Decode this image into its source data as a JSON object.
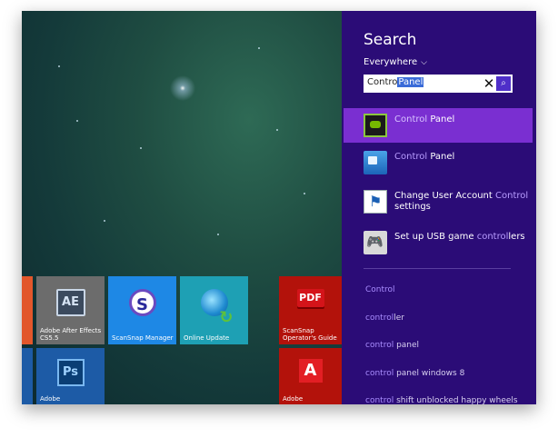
{
  "start_screen": {
    "tiles": [
      {
        "id": "after-effects",
        "label": "Adobe After Effects CS5.5",
        "icon_text": "AE",
        "color": "#6c6c6c"
      },
      {
        "id": "scansnap-manager",
        "label": "ScanSnap Manager",
        "icon_text": "S",
        "color": "#1e88e5"
      },
      {
        "id": "online-update",
        "label": "Online Update",
        "icon_text": "",
        "color": "#1ea0b4"
      },
      {
        "id": "scansnap-guide",
        "label": "ScanSnap Operator's Guide",
        "icon_text": "PDF",
        "color": "#b3120b"
      },
      {
        "id": "photoshop",
        "label": "Adobe",
        "icon_text": "Ps",
        "color": "#1d5ba6"
      },
      {
        "id": "adobe-reader",
        "label": "Adobe",
        "icon_text": "A",
        "color": "#b3120b"
      }
    ]
  },
  "search_panel": {
    "title": "Search",
    "scope": "Everywhere",
    "input_value_typed": "Contro",
    "input_value_selected": "Panel",
    "results": [
      {
        "match": "Control",
        "rest": " Panel",
        "icon": "nvidia-control-panel-icon",
        "selected": true
      },
      {
        "match": "Control",
        "rest": " Panel",
        "icon": "control-panel-icon",
        "selected": false
      },
      {
        "pre": "Change User Account ",
        "match": "Control",
        "rest": " settings",
        "icon": "uac-flag-icon",
        "selected": false
      },
      {
        "pre": "Set up USB game ",
        "match": "control",
        "rest": "lers",
        "icon": "gamepad-icon",
        "selected": false
      }
    ],
    "suggestions": [
      {
        "match": "Control",
        "rest": ""
      },
      {
        "match": "control",
        "rest": "ler"
      },
      {
        "match": "control",
        "rest": " panel"
      },
      {
        "match": "control",
        "rest": " panel windows 8"
      },
      {
        "match": "control",
        "rest": " shift unblocked happy wheels"
      }
    ],
    "colors": {
      "background": "#2b0c77",
      "selected": "#7a2fd1",
      "highlight": "#b89cff"
    }
  }
}
